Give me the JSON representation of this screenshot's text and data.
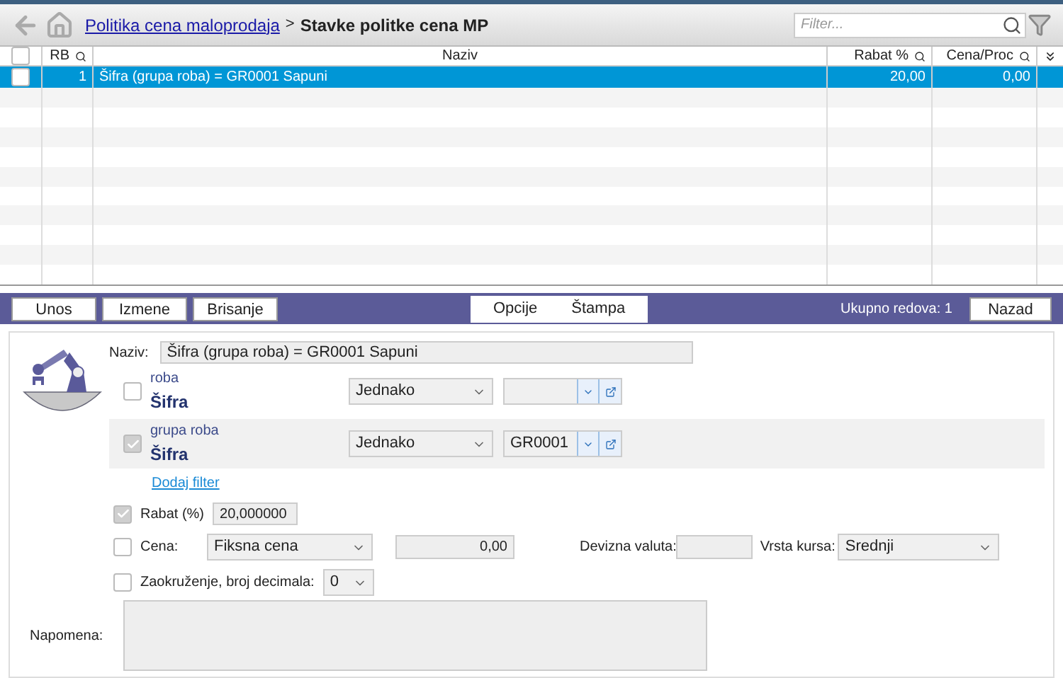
{
  "breadcrumb": {
    "link": "Politika cena maloprodaja",
    "separator": ">",
    "current": "Stavke politke cena MP"
  },
  "filter": {
    "placeholder": "Filter..."
  },
  "table": {
    "all_checked": false,
    "columns": [
      {
        "label": "RB",
        "search": true
      },
      {
        "label": "Naziv",
        "search": false
      },
      {
        "label": "Rabat %",
        "search": true
      },
      {
        "label": "Cena/Proc",
        "search": true
      }
    ],
    "rows": [
      {
        "selected": true,
        "checked": false,
        "cells": [
          "1",
          "Šifra (grupa roba) = GR0001 Sapuni",
          "20,00",
          "0,00"
        ]
      }
    ]
  },
  "toolbar": {
    "left": [
      "Unos",
      "Izmene",
      "Brisanje"
    ],
    "center": [
      "Opcije",
      "Štampa"
    ],
    "total": "Ukupno redova: 1",
    "right": "Nazad"
  },
  "form": {
    "naziv_label": "Naziv:",
    "naziv": "Šifra (grupa roba) = GR0001 Sapuni",
    "filters": [
      {
        "group": "roba",
        "field": "Šifra",
        "checked": false,
        "operator": "Jednako",
        "highlighted": false
      },
      {
        "group": "grupa roba",
        "field": "Šifra",
        "checked": true,
        "operator": "Jednako",
        "value": "GR0001",
        "highlighted": true
      }
    ],
    "add_filter": "Dodaj filter",
    "rabat": {
      "checked": true,
      "label": "Rabat (%)",
      "value": "20,000000"
    },
    "cena": {
      "checked": false,
      "label": "Cena:",
      "type": "Fiksna cena",
      "value": "0,00",
      "currency_label": "Devizna valuta:",
      "rate_label": "Vrsta kursa:",
      "rate": "Srednji"
    },
    "rounding": {
      "checked": false,
      "label": "Zaokruženje, broj decimala:",
      "value": "0"
    },
    "note_label": "Napomena:"
  }
}
